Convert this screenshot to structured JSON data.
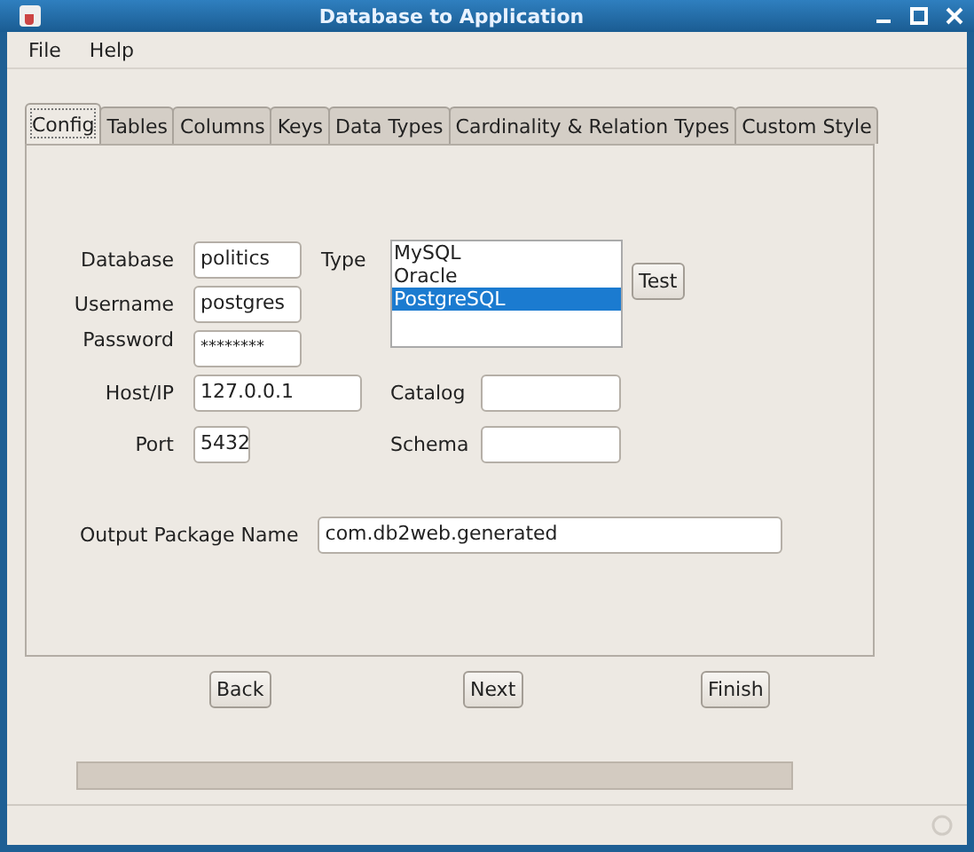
{
  "window": {
    "title": "Database to Application"
  },
  "menu": [
    "File",
    "Help"
  ],
  "tabs": [
    {
      "label": "Config",
      "selected": true
    },
    {
      "label": "Tables",
      "selected": false
    },
    {
      "label": "Columns",
      "selected": false
    },
    {
      "label": "Keys",
      "selected": false
    },
    {
      "label": "Data Types",
      "selected": false
    },
    {
      "label": "Cardinality & Relation Types",
      "selected": false
    },
    {
      "label": "Custom Style",
      "selected": false
    }
  ],
  "form": {
    "database": {
      "label": "Database",
      "value": "politics"
    },
    "username": {
      "label": "Username",
      "value": "postgres"
    },
    "password": {
      "label": "Password",
      "value": "********"
    },
    "host": {
      "label": "Host/IP",
      "value": "127.0.0.1"
    },
    "port": {
      "label": "Port",
      "value": "5432"
    },
    "type": {
      "label": "Type",
      "options": [
        {
          "label": "MySQL",
          "selected": false
        },
        {
          "label": "Oracle",
          "selected": false
        },
        {
          "label": "PostgreSQL",
          "selected": true
        }
      ]
    },
    "test_button": "Test",
    "catalog": {
      "label": "Catalog"
    },
    "schema": {
      "label": "Schema"
    },
    "output_package": {
      "label": "Output Package Name",
      "value": "com.db2web.generated"
    }
  },
  "buttons": [
    "Back",
    "Next",
    "Finish"
  ],
  "progress": {
    "level": 0
  }
}
